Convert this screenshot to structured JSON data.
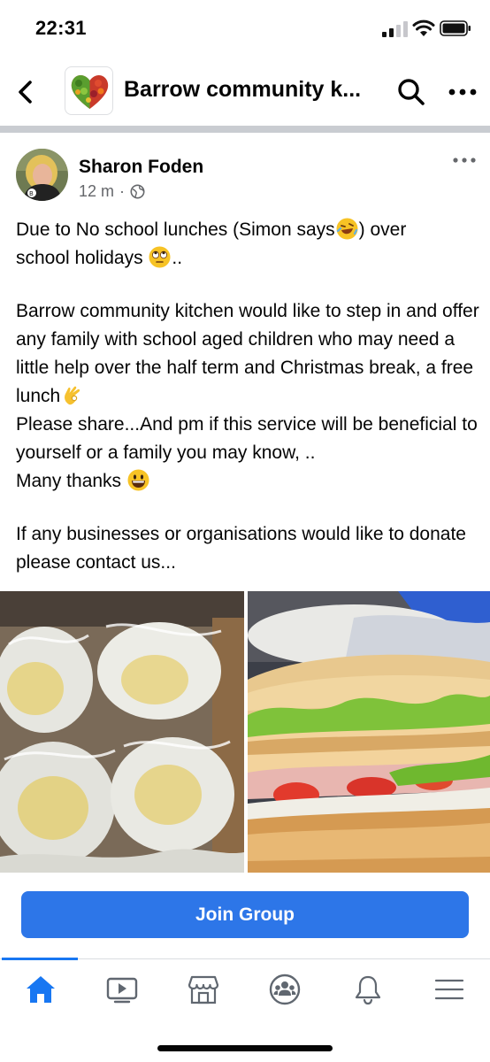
{
  "status_bar": {
    "time": "22:31"
  },
  "header": {
    "group_name": "Barrow community k..."
  },
  "post": {
    "author": "Sharon Foden",
    "time_ago": "12 m",
    "separator": "·",
    "paragraph1_a": "Due to No school lunches (Simon says",
    "paragraph1_b": ") over",
    "paragraph1_c": "school holidays ",
    "paragraph1_d": "..",
    "paragraph2_a": "Barrow community kitchen would like to step in and offer any family with school aged children who may need a little help over the half term and Christmas break, a free lunch",
    "paragraph2_b": "Please share...And pm if this service will be beneficial to yourself or a family you may know, ..",
    "paragraph2_c": "Many thanks ",
    "paragraph3": "If any businesses or organisations would like to donate please contact us..."
  },
  "join_button": {
    "label": "Join Group"
  },
  "tab_bar": {
    "tabs": [
      {
        "icon": "home-icon",
        "active": true
      },
      {
        "icon": "video-icon",
        "active": false
      },
      {
        "icon": "marketplace-icon",
        "active": false
      },
      {
        "icon": "groups-icon",
        "active": false
      },
      {
        "icon": "notifications-icon",
        "active": false
      },
      {
        "icon": "menu-icon",
        "active": false
      }
    ]
  },
  "colors": {
    "accent": "#1877f2",
    "join_button": "#2d76e8",
    "muted_text": "#65676b"
  }
}
